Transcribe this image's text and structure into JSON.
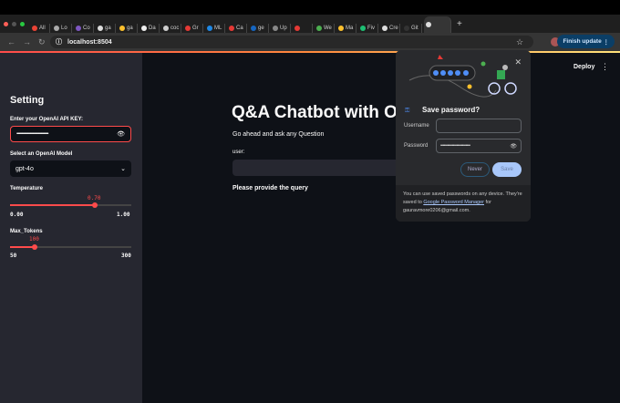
{
  "browser": {
    "tabs": [
      "All",
      "Lo",
      "Co",
      "ga",
      "ga",
      "Da",
      "coc",
      "Gr",
      "ML",
      "Ca",
      "ge",
      "Up",
      "",
      "We",
      "Ma",
      "Fiv",
      "Cre",
      "Git",
      ""
    ],
    "url": "localhost:8504",
    "finish_update": "Finish update"
  },
  "sidebar": {
    "title": "Setting",
    "api_key_label": "Enter your OpenAI API KEY:",
    "api_key_value": "••••••••••••••••••••••••••••••••••••••••••••••",
    "model_label": "Select an OpenAI Model",
    "model_value": "gpt-4o",
    "temperature": {
      "label": "Temperature",
      "value": "0.70",
      "min": "0.00",
      "max": "1.00",
      "fraction": 0.7
    },
    "max_tokens": {
      "label": "Max_Tokens",
      "value": "100",
      "min": "50",
      "max": "300",
      "fraction": 0.2
    }
  },
  "main": {
    "title": "Q&A Chatbot with O",
    "subtitle": "Go ahead and ask any Question",
    "input_label": "user:",
    "message": "Please provide the query",
    "deploy": "Deploy"
  },
  "popup": {
    "title": "Save password?",
    "username_label": "Username",
    "username_value": "",
    "password_label": "Password",
    "password_value": "••••••••••••••••••••••••••",
    "never": "Never",
    "save": "Save",
    "footer_1": "You can use saved passwords on any device. They're saved to",
    "footer_link": "Google Password Manager",
    "footer_2": "for",
    "email": "gauravmore0206@gmail.com."
  }
}
